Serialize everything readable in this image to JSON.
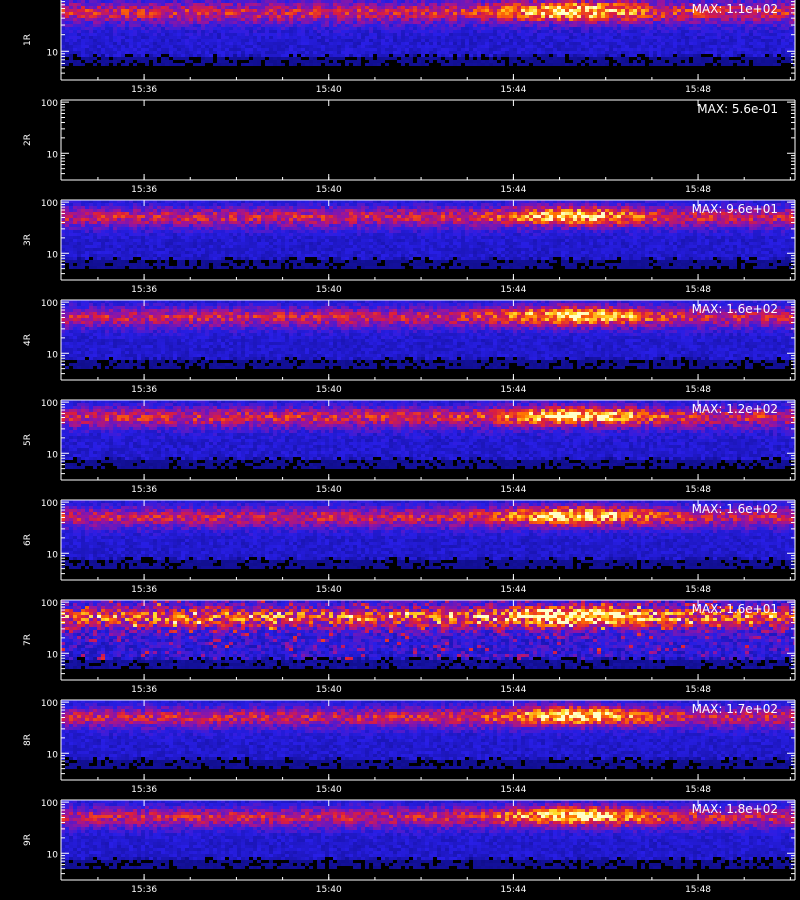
{
  "chart_data": {
    "type": "heatmap",
    "description_scale": "log",
    "x_ticks": [
      "15:36",
      "15:40",
      "15:44",
      "15:48"
    ],
    "x_tick_minutes": [
      36,
      40,
      44,
      48
    ],
    "x_range_minutes": [
      34.2,
      50.1
    ],
    "y_ticks": [
      "100",
      "10"
    ],
    "y_tick_values": [
      100,
      10
    ],
    "y_range": [
      3,
      110
    ],
    "grid": false,
    "xlabel": "",
    "colors": {
      "background": "#000000",
      "low": "#1010c0",
      "mid": "#c01060",
      "high": "#ff6000",
      "peak": "#ffff80",
      "axis": "#ffffff"
    },
    "panels": [
      {
        "label": "1R",
        "max": "MAX: 1.1e+02",
        "intensity": 0.95,
        "noise": 0.55,
        "empty": false,
        "top_clipped": true
      },
      {
        "label": "2R",
        "max": "MAX: 5.6e-01",
        "intensity": 0.0,
        "noise": 0.0,
        "empty": true,
        "top_clipped": false
      },
      {
        "label": "3R",
        "max": "MAX: 9.6e+01",
        "intensity": 0.9,
        "noise": 0.5,
        "empty": false,
        "top_clipped": false
      },
      {
        "label": "4R",
        "max": "MAX: 1.6e+02",
        "intensity": 1.0,
        "noise": 0.5,
        "empty": false,
        "top_clipped": false
      },
      {
        "label": "5R",
        "max": "MAX: 1.2e+02",
        "intensity": 0.95,
        "noise": 0.55,
        "empty": false,
        "top_clipped": false
      },
      {
        "label": "6R",
        "max": "MAX: 1.6e+02",
        "intensity": 1.0,
        "noise": 0.5,
        "empty": false,
        "top_clipped": false
      },
      {
        "label": "7R",
        "max": "MAX: 1.6e+01",
        "intensity": 0.8,
        "noise": 0.9,
        "empty": false,
        "top_clipped": false
      },
      {
        "label": "8R",
        "max": "MAX: 1.7e+02",
        "intensity": 1.0,
        "noise": 0.5,
        "empty": false,
        "top_clipped": false
      },
      {
        "label": "9R",
        "max": "MAX: 1.8e+02",
        "intensity": 1.0,
        "noise": 0.5,
        "empty": false,
        "top_clipped": false
      }
    ]
  }
}
